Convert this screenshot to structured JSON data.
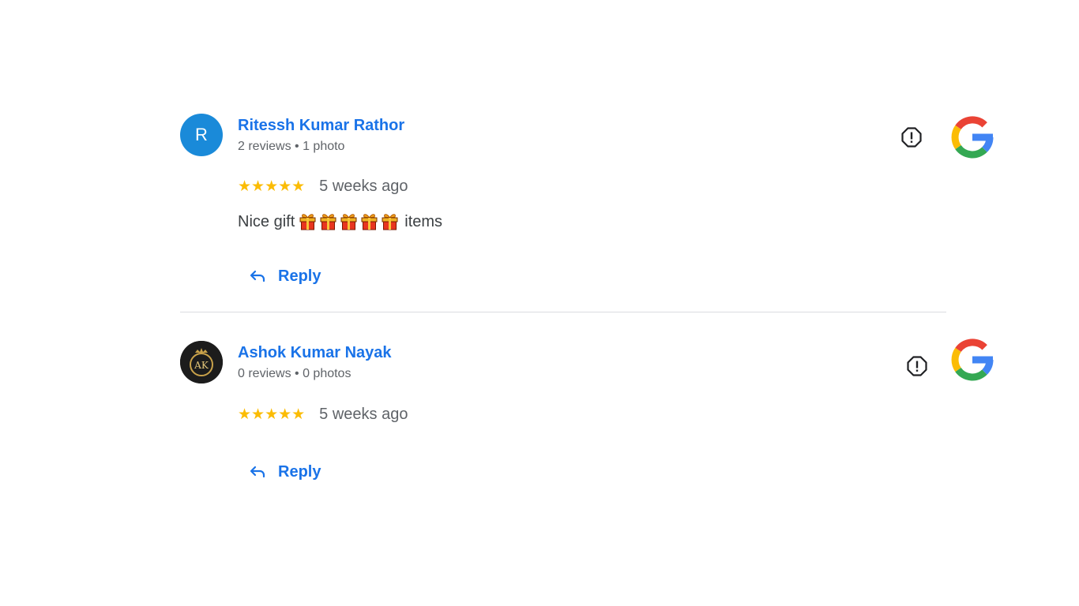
{
  "reviews": [
    {
      "author": "Ritessh Kumar Rathor",
      "avatar_letter": "R",
      "avatar_color": "#1a8ad9",
      "meta": "2 reviews • 1 photo",
      "rating": 5,
      "stars": "★★★★★",
      "timestamp": "5 weeks ago",
      "text_before": "Nice gift",
      "emoji_icon": "wrapped-gift",
      "emoji_count": 5,
      "text_after": "items",
      "reply_label": "Reply"
    },
    {
      "author": "Ashok Kumar Nayak",
      "avatar_text": "AK",
      "meta": "0 reviews • 0 photos",
      "rating": 5,
      "stars": "★★★★★",
      "timestamp": "5 weeks ago",
      "reply_label": "Reply"
    }
  ],
  "colors": {
    "accent": "#1a73e8",
    "star": "#fbbc04",
    "muted": "#5f6368",
    "divider": "#dadce0"
  }
}
